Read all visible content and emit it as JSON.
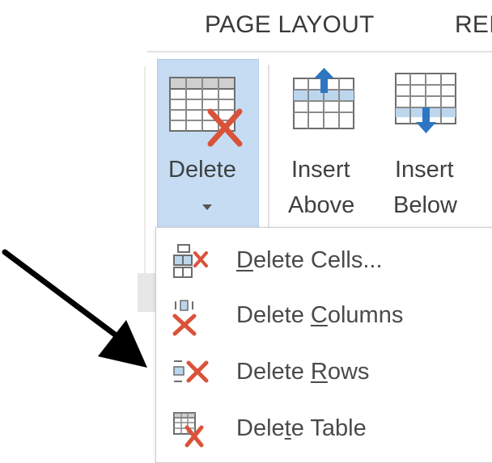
{
  "ribbon": {
    "tabs": [
      {
        "label": "PAGE LAYOUT"
      },
      {
        "label": "REI"
      }
    ]
  },
  "buttons": {
    "delete": {
      "label": "Delete"
    },
    "insert_above": {
      "line1": "Insert",
      "line2": "Above"
    },
    "insert_below": {
      "line1": "Insert",
      "line2": "Below"
    }
  },
  "delete_menu": {
    "items": [
      {
        "before": "",
        "accel": "D",
        "after": "elete Cells...",
        "icon": "delete-cells-icon"
      },
      {
        "before": "Delete ",
        "accel": "C",
        "after": "olumns",
        "icon": "delete-columns-icon"
      },
      {
        "before": "Delete ",
        "accel": "R",
        "after": "ows",
        "icon": "delete-rows-icon"
      },
      {
        "before": "Dele",
        "accel": "t",
        "after": "e Table",
        "icon": "delete-table-icon"
      }
    ]
  },
  "colors": {
    "selected_button_bg": "#c5dcf3",
    "delete_x": "#d9533a",
    "arrow_blue": "#2e75c2"
  }
}
